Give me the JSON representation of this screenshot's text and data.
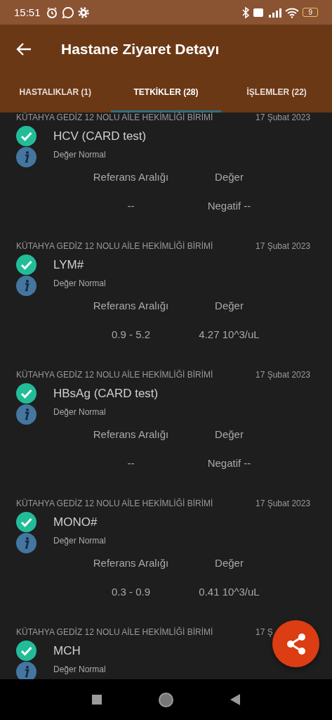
{
  "status_bar": {
    "time": "15:51",
    "battery": "9"
  },
  "app_bar": {
    "title": "Hastane Ziyaret Detayı"
  },
  "tabs": [
    {
      "label": "HASTALIKLAR (1)",
      "selected": false
    },
    {
      "label": "TETKİKLER (28)",
      "selected": true
    },
    {
      "label": "İŞLEMLER (22)",
      "selected": false
    }
  ],
  "results": [
    {
      "institution": "KÜTAHYA GEDİZ 12 NOLU AİLE HEKİMLİĞİ BİRİMİ",
      "date": "17 Şubat 2023",
      "test": "HCV (CARD test)",
      "status": "Değer Normal",
      "range_label": "Referans Aralığı",
      "value_label": "Değer",
      "range": "--",
      "value": "Negatif --"
    },
    {
      "institution": "KÜTAHYA GEDİZ 12 NOLU AİLE HEKİMLİĞİ BİRİMİ",
      "date": "17 Şubat 2023",
      "test": "LYM#",
      "status": "Değer Normal",
      "range_label": "Referans Aralığı",
      "value_label": "Değer",
      "range": "0.9 - 5.2",
      "value": "4.27 10^3/uL"
    },
    {
      "institution": "KÜTAHYA GEDİZ 12 NOLU AİLE HEKİMLİĞİ BİRİMİ",
      "date": "17 Şubat 2023",
      "test": "HBsAg (CARD test)",
      "status": "Değer Normal",
      "range_label": "Referans Aralığı",
      "value_label": "Değer",
      "range": "--",
      "value": "Negatif --"
    },
    {
      "institution": "KÜTAHYA GEDİZ 12 NOLU AİLE HEKİMLİĞİ BİRİMİ",
      "date": "17 Şubat 2023",
      "test": "MONO#",
      "status": "Değer Normal",
      "range_label": "Referans Aralığı",
      "value_label": "Değer",
      "range": "0.3 - 0.9",
      "value": "0.41 10^3/uL"
    },
    {
      "institution": "KÜTAHYA GEDİZ 12 NOLU AİLE HEKİMLİĞİ BİRİMİ",
      "date": "17 Ş",
      "test": "MCH",
      "status": "Değer Normal"
    }
  ]
}
